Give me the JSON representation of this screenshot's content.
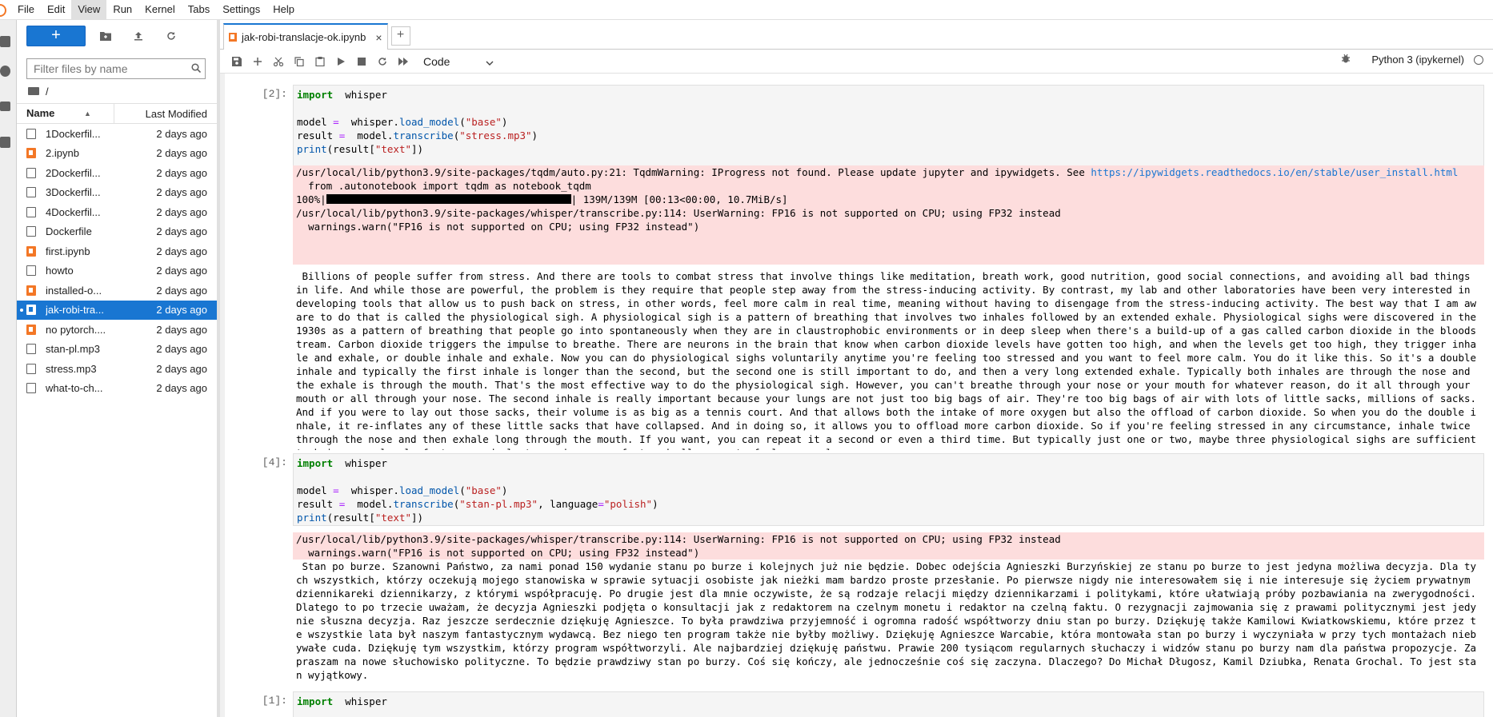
{
  "menubar": {
    "items": [
      "File",
      "Edit",
      "View",
      "Run",
      "Kernel",
      "Tabs",
      "Settings",
      "Help"
    ],
    "active": "View"
  },
  "filebrowser": {
    "new_label": "+",
    "filter_placeholder": "Filter files by name",
    "breadcrumb": "/",
    "col_name": "Name",
    "col_modified": "Last Modified",
    "files": [
      {
        "name": "1Dockerfil...",
        "modified": "2 days ago",
        "type": "file"
      },
      {
        "name": "2.ipynb",
        "modified": "2 days ago",
        "type": "notebook"
      },
      {
        "name": "2Dockerfil...",
        "modified": "2 days ago",
        "type": "file"
      },
      {
        "name": "3Dockerfil...",
        "modified": "2 days ago",
        "type": "file"
      },
      {
        "name": "4Dockerfil...",
        "modified": "2 days ago",
        "type": "file"
      },
      {
        "name": "Dockerfile",
        "modified": "2 days ago",
        "type": "file"
      },
      {
        "name": "first.ipynb",
        "modified": "2 days ago",
        "type": "notebook"
      },
      {
        "name": "howto",
        "modified": "2 days ago",
        "type": "file"
      },
      {
        "name": "installed-o...",
        "modified": "2 days ago",
        "type": "notebook"
      },
      {
        "name": "jak-robi-tra...",
        "modified": "2 days ago",
        "type": "notebook",
        "selected": true
      },
      {
        "name": "no pytorch....",
        "modified": "2 days ago",
        "type": "notebook"
      },
      {
        "name": "stan-pl.mp3",
        "modified": "2 days ago",
        "type": "file"
      },
      {
        "name": "stress.mp3",
        "modified": "2 days ago",
        "type": "file"
      },
      {
        "name": "what-to-ch...",
        "modified": "2 days ago",
        "type": "file"
      }
    ]
  },
  "tab": {
    "title": "jak-robi-translacje-ok.ipynb",
    "close": "×",
    "add": "+"
  },
  "toolbar": {
    "cell_type": "Code",
    "kernel": "Python 3 (ipykernel)"
  },
  "cells": [
    {
      "prompt": "[2]:",
      "code": [
        [
          [
            "kw",
            "import"
          ],
          [
            "",
            "  whisper"
          ]
        ],
        [],
        [
          [
            "",
            "model "
          ],
          [
            "op",
            "="
          ],
          [
            "",
            "  whisper."
          ],
          [
            "fn",
            "load_model"
          ],
          [
            "",
            "("
          ],
          [
            "str",
            "\"base\""
          ],
          [
            "",
            ")"
          ]
        ],
        [
          [
            "",
            "result "
          ],
          [
            "op",
            "="
          ],
          [
            "",
            "  model."
          ],
          [
            "fn",
            "transcribe"
          ],
          [
            "",
            "("
          ],
          [
            "str",
            "\"stress.mp3\""
          ],
          [
            "",
            ")"
          ]
        ],
        [
          [
            "fn",
            "print"
          ],
          [
            "",
            "(result["
          ],
          [
            "str",
            "\"text\""
          ],
          [
            "",
            "])"
          ]
        ]
      ],
      "stderr_1": "/usr/local/lib/python3.9/site-packages/tqdm/auto.py:21: TqdmWarning: IProgress not found. Please update jupyter and ipywidgets. See ",
      "stderr_link": "https://ipywidgets.readthedocs.io/en/stable/user_install.html",
      "stderr_2": "\n  from .autonotebook import tqdm as notebook_tqdm\n100%|",
      "stderr_progress": 1.0,
      "stderr_3": "| 139M/139M [00:13<00:00, 10.7MiB/s]\n/usr/local/lib/python3.9/site-packages/whisper/transcribe.py:114: UserWarning: FP16 is not supported on CPU; using FP32 instead\n  warnings.warn(\"FP16 is not supported on CPU; using FP32 instead\")",
      "stdout": " Billions of people suffer from stress. And there are tools to combat stress that involve things like meditation, breath work, good nutrition, good social connections, and avoiding all bad things in life. And while those are powerful, the problem is they require that people step away from the stress-inducing activity. By contrast, my lab and other laboratories have been very interested in developing tools that allow us to push back on stress, in other words, feel more calm in real time, meaning without having to disengage from the stress-inducing activity. The best way that I am aware to do that is called the physiological sigh. A physiological sigh is a pattern of breathing that involves two inhales followed by an extended exhale. Physiological sighs were discovered in the 1930s as a pattern of breathing that people go into spontaneously when they are in claustrophobic environments or in deep sleep when there's a build-up of a gas called carbon dioxide in the bloodstream. Carbon dioxide triggers the impulse to breathe. There are neurons in the brain that know when carbon dioxide levels have gotten too high, and when the levels get too high, they trigger inhale and exhale, or double inhale and exhale. Now you can do physiological sighs voluntarily anytime you're feeling too stressed and you want to feel more calm. You do it like this. So it's a double inhale and typically the first inhale is longer than the second, but the second one is still important to do, and then a very long extended exhale. Typically both inhales are through the nose and the exhale is through the mouth. That's the most effective way to do the physiological sigh. However, you can't breathe through your nose or your mouth for whatever reason, do it all through your mouth or all through your nose. The second inhale is really important because your lungs are not just too big bags of air. They're too big bags of air with lots of little sacks, millions of sacks. And if you were to lay out those sacks, their volume is as big as a tennis court. And that allows both the intake of more oxygen but also the offload of carbon dioxide. So when you do the double inhale, it re-inflates any of these little sacks that have collapsed. And in doing so, it allows you to offload more carbon dioxide. So if you're feeling stressed in any circumstance, inhale twice through the nose and then exhale long through the mouth. If you want, you can repeat it a second or even a third time. But typically just one or two, maybe three physiological sighs are sufficient to bring your level of stress and alertness down very fast and allow you to feel more calm."
    },
    {
      "prompt": "[4]:",
      "code": [
        [
          [
            "kw",
            "import"
          ],
          [
            "",
            "  whisper"
          ]
        ],
        [],
        [
          [
            "",
            "model "
          ],
          [
            "op",
            "="
          ],
          [
            "",
            "  whisper."
          ],
          [
            "fn",
            "load_model"
          ],
          [
            "",
            "("
          ],
          [
            "str",
            "\"base\""
          ],
          [
            "",
            ")"
          ]
        ],
        [
          [
            "",
            "result "
          ],
          [
            "op",
            "="
          ],
          [
            "",
            "  model."
          ],
          [
            "fn",
            "transcribe"
          ],
          [
            "",
            "("
          ],
          [
            "str",
            "\"stan-pl.mp3\""
          ],
          [
            "",
            ", language"
          ],
          [
            "op",
            "="
          ],
          [
            "str",
            "\"polish\""
          ],
          [
            "",
            ")"
          ]
        ],
        [
          [
            "fn",
            "print"
          ],
          [
            "",
            "(result["
          ],
          [
            "str",
            "\"text\""
          ],
          [
            "",
            "])"
          ]
        ]
      ],
      "stderr": "/usr/local/lib/python3.9/site-packages/whisper/transcribe.py:114: UserWarning: FP16 is not supported on CPU; using FP32 instead\n  warnings.warn(\"FP16 is not supported on CPU; using FP32 instead\")",
      "stdout": " Stan po burze. Szanowni Państwo, za nami ponad 150 wydanie stanu po burze i kolejnych już nie będzie. Dobec odejścia Agnieszki Burzyńskiej ze stanu po burze to jest jedyna możliwa decyzja. Dla tych wszystkich, którzy oczekują mojego stanowiska w sprawie sytuacji osobiste jak nieżki mam bardzo proste przesłanie. Po pierwsze nigdy nie interesowałem się i nie interesuje się życiem prywatnym dziennikareki dziennikarzy, z którymi współpracuję. Po drugie jest dla mnie oczywiste, że są rodzaje relacji między dziennikarzami i politykami, które ułatwiają próby pozbawiania na zwerygodności. Dlatego to po trzecie uważam, że decyzja Agnieszki podjęta o konsultacji jak z redaktorem na czelnym monetu i redaktor na czelną faktu. O rezygnacji zajmowania się z prawami politycznymi jest jedynie słuszna decyzja. Raz jeszcze serdecznie dziękuję Agnieszce. To była prawdziwa przyjemność i ogromna radość współtworzy dniu stan po burzy. Dziękuję także Kamilowi Kwiatkowskiemu, które przez te wszystkie lata był naszym fantastycznym wydawcą. Bez niego ten program także nie byłby możliwy. Dziękuję Agnieszce Warcabie, która montowała stan po burzy i wyczyniała w przy tych montażach niebywałe cuda. Dziękuję tym wszystkim, którzy program współtworzyli. Ale najbardziej dziękuję państwu. Prawie 200 tysiącom regularnych słuchaczy i widzów stanu po burzy nam dla państwa propozycje. Zapraszam na nowe słuchowisko polityczne. To będzie prawdziwy stan po burzy. Coś się kończy, ale jednocześnie coś się zaczyna. Dlaczego? Do Michał Długosz, Kamil Dziubka, Renata Grochal. To jest stan wyjątkowy."
    },
    {
      "prompt": "[1]:",
      "code": [
        [
          [
            "kw",
            "import"
          ],
          [
            "",
            "  whisper"
          ]
        ]
      ]
    }
  ]
}
